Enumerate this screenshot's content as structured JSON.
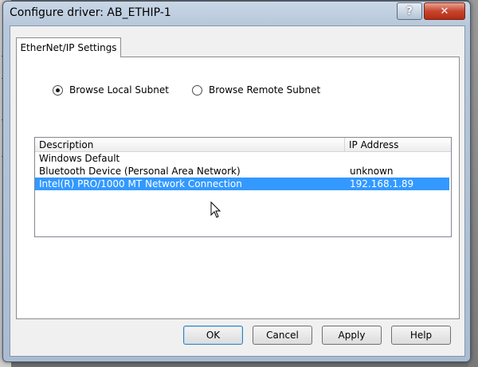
{
  "window": {
    "title": "Configure driver: AB_ETHIP-1",
    "help_label": "?",
    "close_label": "✕"
  },
  "tab": {
    "label": "EtherNet/IP Settings"
  },
  "browse": {
    "local_label": "Browse Local Subnet",
    "remote_label": "Browse Remote Subnet",
    "selected": "local"
  },
  "list": {
    "columns": [
      "Description",
      "IP Address"
    ],
    "rows": [
      {
        "description": "Windows Default",
        "ip": ""
      },
      {
        "description": "Bluetooth Device (Personal Area Network)",
        "ip": "unknown"
      },
      {
        "description": "Intel(R) PRO/1000 MT Network Connection",
        "ip": "192.168.1.89"
      }
    ],
    "selected_index": 2
  },
  "buttons": {
    "ok": "OK",
    "cancel": "Cancel",
    "apply": "Apply",
    "help": "Help"
  },
  "colors": {
    "selection": "#3399ff",
    "close_button": "#c7452c"
  }
}
